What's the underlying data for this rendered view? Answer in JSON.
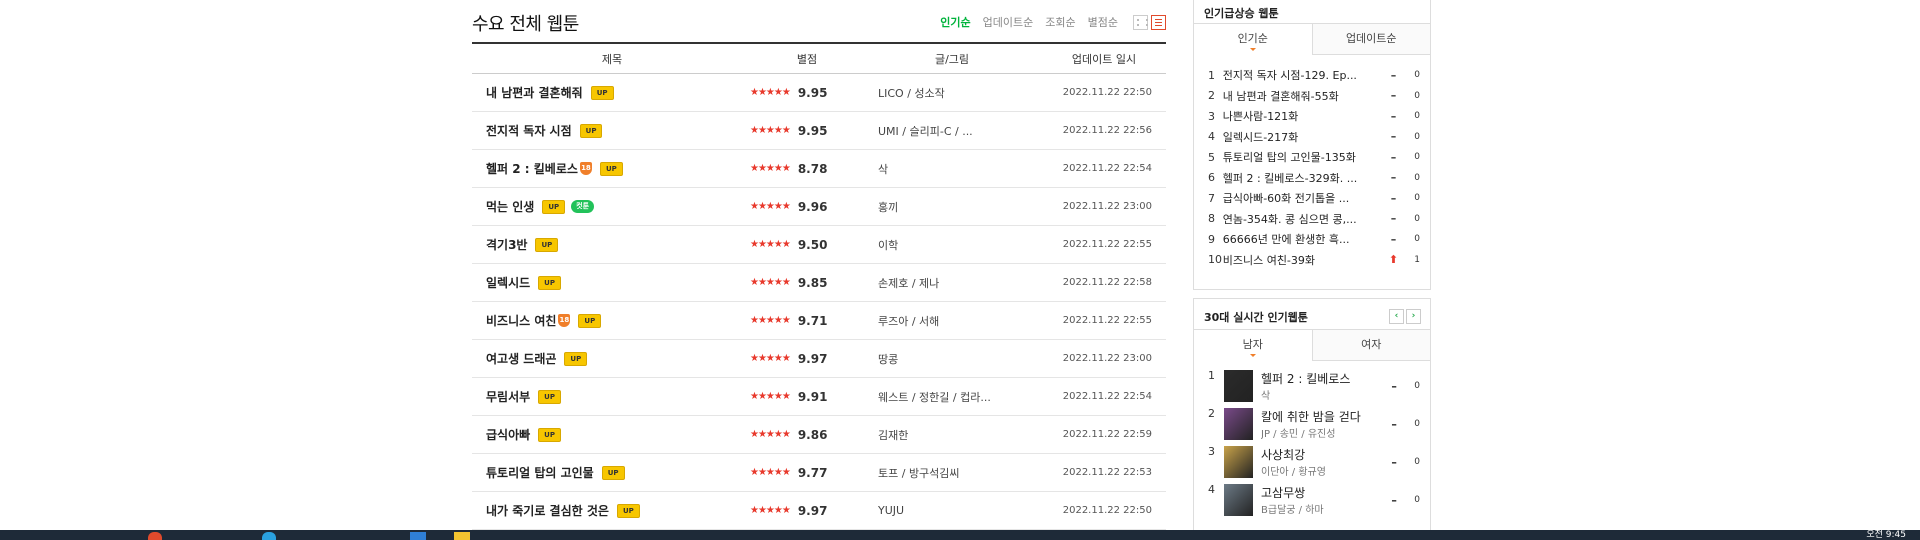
{
  "main": {
    "title": "수요 전체 웹툰",
    "sort_options": [
      {
        "label": "인기순",
        "active": true
      },
      {
        "label": "업데이트순",
        "active": false
      },
      {
        "label": "조회순",
        "active": false
      },
      {
        "label": "별점순",
        "active": false
      }
    ],
    "headers": {
      "title": "제목",
      "rating": "별점",
      "author": "글/그림",
      "date": "업데이트 일시"
    },
    "rows": [
      {
        "title": "내 남편과 결혼해줘",
        "badges": [
          "up"
        ],
        "stars": 5,
        "score": "9.95",
        "author": "LICO / 성소작",
        "date": "2022.11.22 22:50"
      },
      {
        "title": "전지적 독자 시점",
        "badges": [
          "up"
        ],
        "stars": 5,
        "score": "9.95",
        "author": "UMI / 슬리피-C / ...",
        "date": "2022.11.22 22:56"
      },
      {
        "title": "헬퍼 2 : 킬베로스",
        "badges": [
          "18",
          "up"
        ],
        "stars": 4.5,
        "score": "8.78",
        "author": "삭",
        "date": "2022.11.22 22:54"
      },
      {
        "title": "먹는 인생",
        "badges": [
          "up",
          "cut"
        ],
        "stars": 5,
        "score": "9.96",
        "author": "홍끼",
        "date": "2022.11.22 23:00"
      },
      {
        "title": "격기3반",
        "badges": [
          "up"
        ],
        "stars": 5,
        "score": "9.50",
        "author": "이학",
        "date": "2022.11.22 22:55"
      },
      {
        "title": "일렉시드",
        "badges": [
          "up"
        ],
        "stars": 5,
        "score": "9.85",
        "author": "손제호 / 제나",
        "date": "2022.11.22 22:58"
      },
      {
        "title": "비즈니스 여친",
        "badges": [
          "18",
          "up"
        ],
        "stars": 5,
        "score": "9.71",
        "author": "루즈아 / 서해",
        "date": "2022.11.22 22:55"
      },
      {
        "title": "여고생 드래곤",
        "badges": [
          "up"
        ],
        "stars": 5,
        "score": "9.97",
        "author": "땅콩",
        "date": "2022.11.22 23:00"
      },
      {
        "title": "무림서부",
        "badges": [
          "up"
        ],
        "stars": 5,
        "score": "9.91",
        "author": "웨스트 / 정한길 / 컵라...",
        "date": "2022.11.22 22:54"
      },
      {
        "title": "급식아빠",
        "badges": [
          "up"
        ],
        "stars": 5,
        "score": "9.86",
        "author": "김재한",
        "date": "2022.11.22 22:59"
      },
      {
        "title": "튜토리얼 탑의 고인물",
        "badges": [
          "up"
        ],
        "stars": 5,
        "score": "9.77",
        "author": "토프 / 방구석김씨",
        "date": "2022.11.22 22:53"
      },
      {
        "title": "내가 죽기로 결심한 것은",
        "badges": [
          "up"
        ],
        "stars": 5,
        "score": "9.97",
        "author": "YUJU",
        "date": "2022.11.22 22:50"
      }
    ],
    "badge_labels": {
      "up": "UP",
      "cut": "컷툰",
      "18": "18"
    }
  },
  "rising": {
    "title": "인기급상승 웹툰",
    "tabs": [
      {
        "label": "인기순",
        "active": true
      },
      {
        "label": "업데이트순",
        "active": false
      }
    ],
    "items": [
      {
        "rank": "1",
        "name": "전지적 독자 시점-129. Ep...",
        "change": "–",
        "count": "0"
      },
      {
        "rank": "2",
        "name": "내 남편과 결혼해줘-55화",
        "change": "–",
        "count": "0"
      },
      {
        "rank": "3",
        "name": "나쁜사람-121화",
        "change": "–",
        "count": "0"
      },
      {
        "rank": "4",
        "name": "일렉시드-217화",
        "change": "–",
        "count": "0"
      },
      {
        "rank": "5",
        "name": "튜토리얼 탑의 고인물-135화",
        "change": "–",
        "count": "0"
      },
      {
        "rank": "6",
        "name": "헬퍼 2 : 킬베로스-329화. ...",
        "change": "–",
        "count": "0"
      },
      {
        "rank": "7",
        "name": "급식아빠-60화 전기톱을 ...",
        "change": "–",
        "count": "0"
      },
      {
        "rank": "8",
        "name": "연놈-354화. 콩 심으면 콩,...",
        "change": "–",
        "count": "0"
      },
      {
        "rank": "9",
        "name": "66666년 만에 환생한 흑...",
        "change": "–",
        "count": "0"
      },
      {
        "rank": "10",
        "name": "비즈니스 여친-39화",
        "change": "⬆",
        "change_dir": "up",
        "count": "1"
      }
    ]
  },
  "realtime": {
    "title": "30대 실시간 인기웹툰",
    "prev": "‹",
    "next": "›",
    "tabs": [
      {
        "label": "남자",
        "active": true
      },
      {
        "label": "여자",
        "active": false
      }
    ],
    "items": [
      {
        "rank": "1",
        "title": "헬퍼 2 : 킬베로스",
        "author": "삭",
        "change": "–",
        "count": "0",
        "thumb_color": "#2b2b2b"
      },
      {
        "rank": "2",
        "title": "칼에 취한 밤을 걷다",
        "author": "JP / 송민 / 유진성",
        "change": "–",
        "count": "0",
        "thumb_color": "#7a4a8a"
      },
      {
        "rank": "3",
        "title": "사상최강",
        "author": "이단아 / 황규영",
        "change": "–",
        "count": "0",
        "thumb_color": "#c9a34a"
      },
      {
        "rank": "4",
        "title": "고삼무쌍",
        "author": "B급달궁 / 하마",
        "change": "–",
        "count": "0",
        "thumb_color": "#6c7a86"
      }
    ]
  },
  "taskbar": {
    "clock": "오전 9:45"
  }
}
